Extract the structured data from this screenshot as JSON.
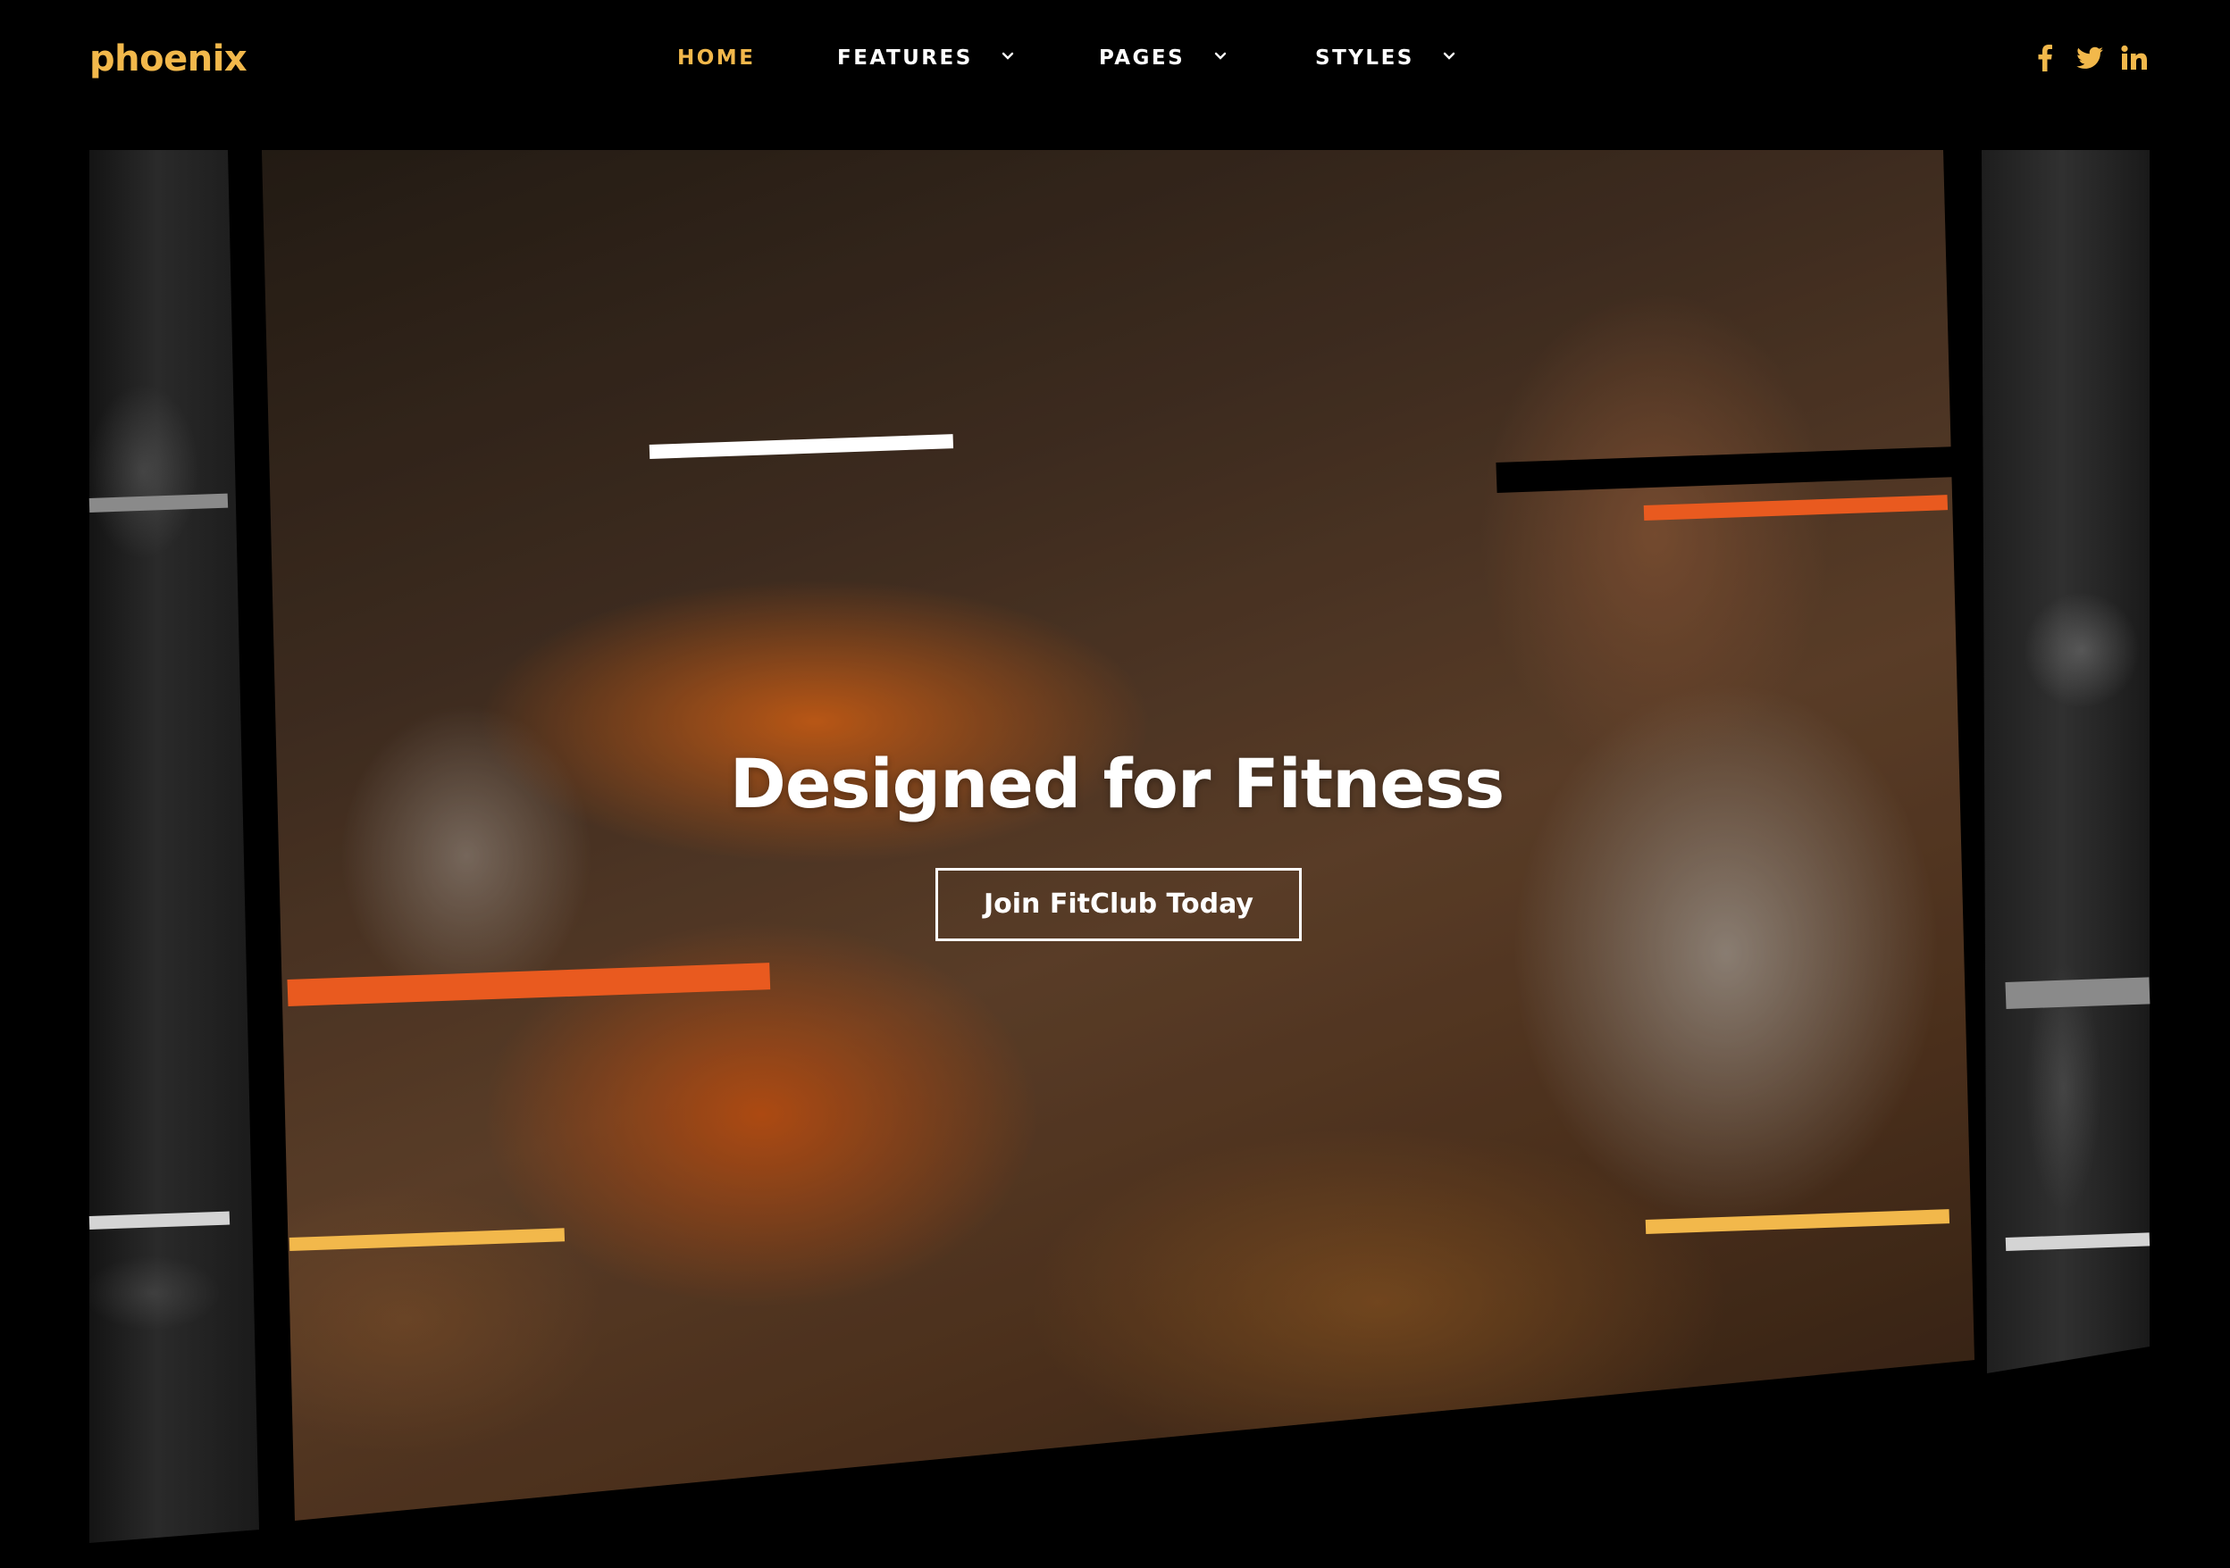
{
  "brand": {
    "logo_text": "phoenix"
  },
  "nav": {
    "items": [
      {
        "label": "HOME",
        "active": true,
        "has_dropdown": false
      },
      {
        "label": "FEATURES",
        "active": false,
        "has_dropdown": true
      },
      {
        "label": "PAGES",
        "active": false,
        "has_dropdown": true
      },
      {
        "label": "STYLES",
        "active": false,
        "has_dropdown": true
      }
    ],
    "social": [
      {
        "name": "facebook-icon"
      },
      {
        "name": "twitter-icon"
      },
      {
        "name": "linkedin-icon"
      }
    ]
  },
  "hero": {
    "title": "Designed for Fitness",
    "cta_label": "Join FitClub Today"
  },
  "colors": {
    "accent_gold": "#F2B84B",
    "accent_orange": "#E95A1F",
    "stripe_white": "#FFFFFF",
    "stripe_gray": "#8A8A8A",
    "stripe_light": "#D4D4D4",
    "background": "#000000",
    "nav_text": "#FFFFFF"
  }
}
